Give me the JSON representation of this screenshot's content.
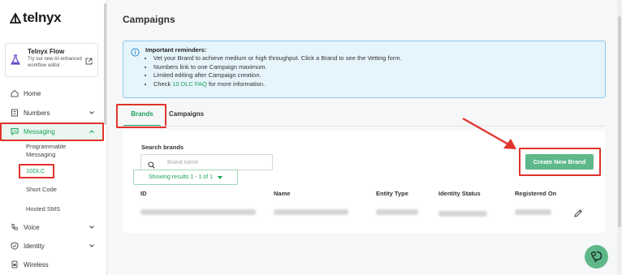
{
  "sidebar": {
    "logo": "telnyx",
    "flow_card": {
      "title": "Telnyx Flow",
      "description": "Try our new AI-enhanced workflow editor"
    },
    "items": [
      {
        "label": "Home",
        "icon": "home-icon"
      },
      {
        "label": "Numbers",
        "icon": "numbers-icon"
      },
      {
        "label": "Messaging",
        "icon": "messaging-icon"
      },
      {
        "label": "Voice",
        "icon": "voice-icon"
      },
      {
        "label": "Identity",
        "icon": "identity-icon"
      },
      {
        "label": "Wireless",
        "icon": "wireless-icon"
      }
    ],
    "sub_items": [
      "Programmable Messaging",
      "10DLC",
      "Short Code",
      "Hosted SMS"
    ]
  },
  "page": {
    "title": "Campaigns"
  },
  "notice": {
    "heading": "Important reminders:",
    "items": [
      "Vet your Brand to achieve medium or high throughput. Click a Brand to see the Vetting form.",
      "Numbers link to one Campaign maximum.",
      "Limited editing after Campaign creation."
    ],
    "faq_prefix": "Check ",
    "faq_link": "10 DLC FAQ",
    "faq_suffix": " for more information."
  },
  "tabs": [
    "Brands",
    "Campaigns"
  ],
  "search": {
    "label": "Search brands",
    "placeholder": "Brand name"
  },
  "showing": "Showing results 1 - 1 of 1",
  "create_button": "Create New Brand",
  "table": {
    "headers": [
      "ID",
      "Name",
      "Entity Type",
      "Identity Status",
      "Registered On"
    ]
  },
  "colors": {
    "accent": "#1ba35c",
    "button": "#5fb88a",
    "annotation": "#e0332c",
    "notice_bg": "#e6f4fc"
  }
}
